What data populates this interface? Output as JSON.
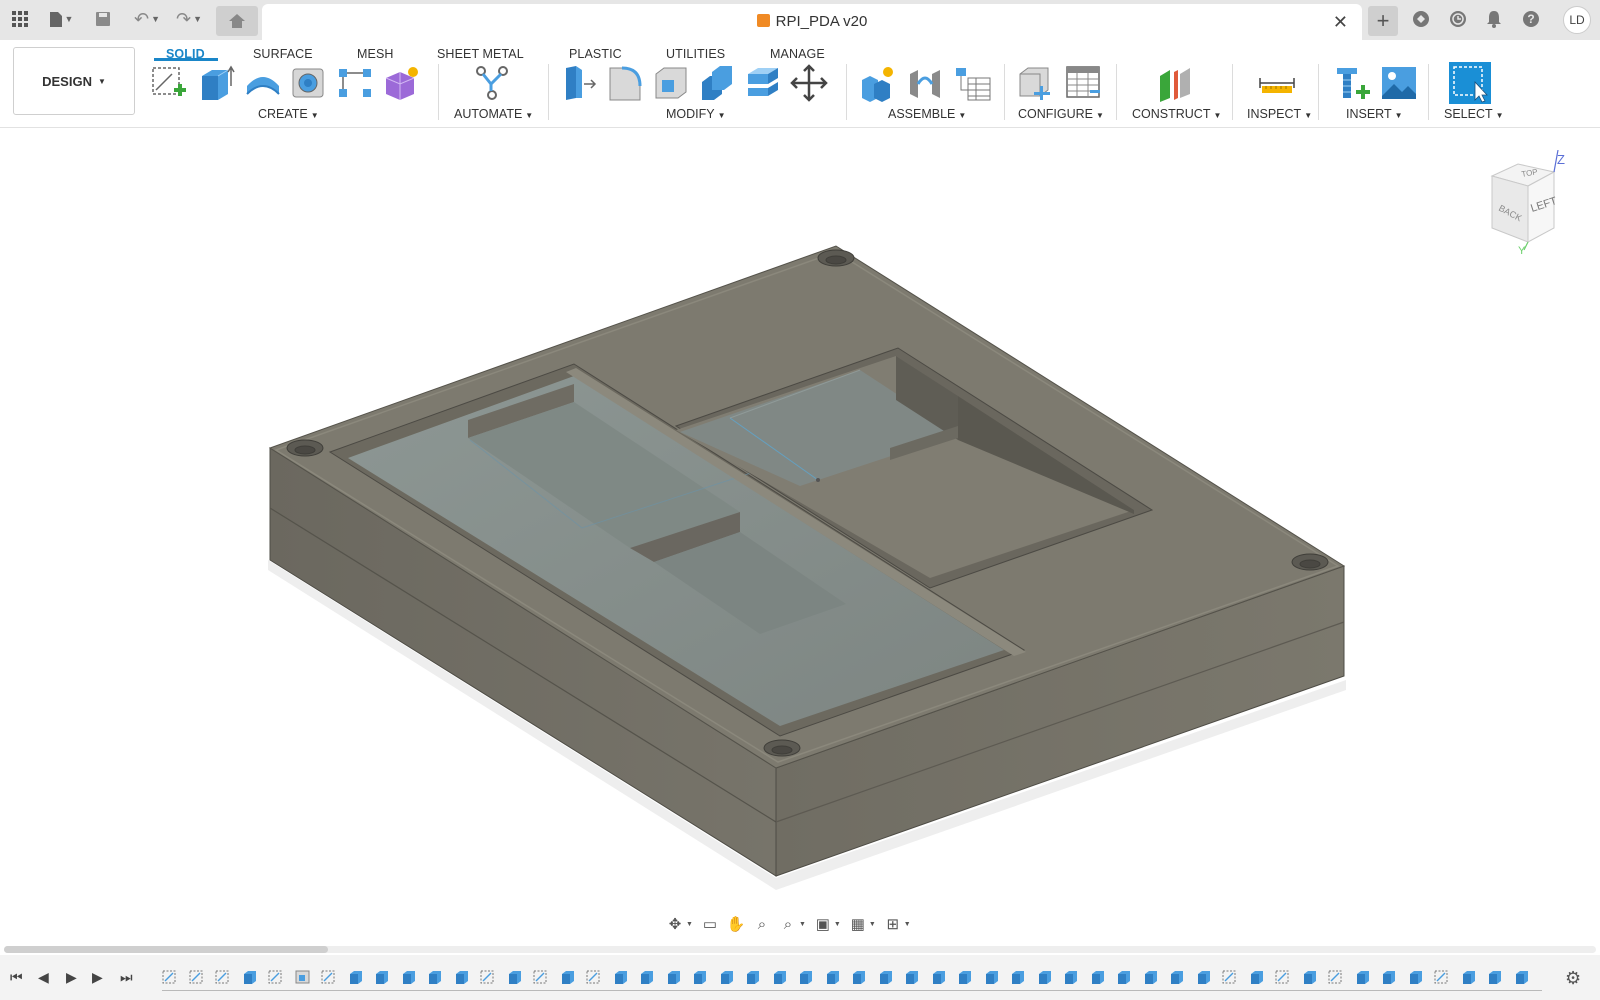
{
  "titlebar": {
    "document_title": "RPI_PDA v20",
    "user_initials": "LD",
    "icons": [
      "app-grid-icon",
      "file-icon",
      "save-icon",
      "undo-icon",
      "redo-icon",
      "home-icon",
      "plus-icon",
      "extensions-icon",
      "job-status-icon",
      "notifications-icon",
      "help-icon"
    ]
  },
  "toolbar": {
    "workspace": "DESIGN",
    "tabs": [
      {
        "label": "SOLID",
        "active": true
      },
      {
        "label": "SURFACE",
        "active": false
      },
      {
        "label": "MESH",
        "active": false
      },
      {
        "label": "SHEET METAL",
        "active": false
      },
      {
        "label": "PLASTIC",
        "active": false
      },
      {
        "label": "UTILITIES",
        "active": false
      },
      {
        "label": "MANAGE",
        "active": false
      }
    ],
    "groups": {
      "create": "CREATE",
      "automate": "AUTOMATE",
      "modify": "MODIFY",
      "assemble": "ASSEMBLE",
      "configure": "CONFIGURE",
      "construct": "CONSTRUCT",
      "inspect": "INSPECT",
      "insert": "INSERT",
      "select": "SELECT"
    }
  },
  "viewcube": {
    "faces": [
      "TOP",
      "BACK",
      "LEFT"
    ],
    "axes": [
      "Z",
      "Y"
    ]
  },
  "timeline": {
    "feature_count": 52
  },
  "colors": {
    "accent": "#1a86c8",
    "model_top": "#7d7a6f",
    "model_side": "#6f6c62",
    "pocket": "#828a88"
  }
}
